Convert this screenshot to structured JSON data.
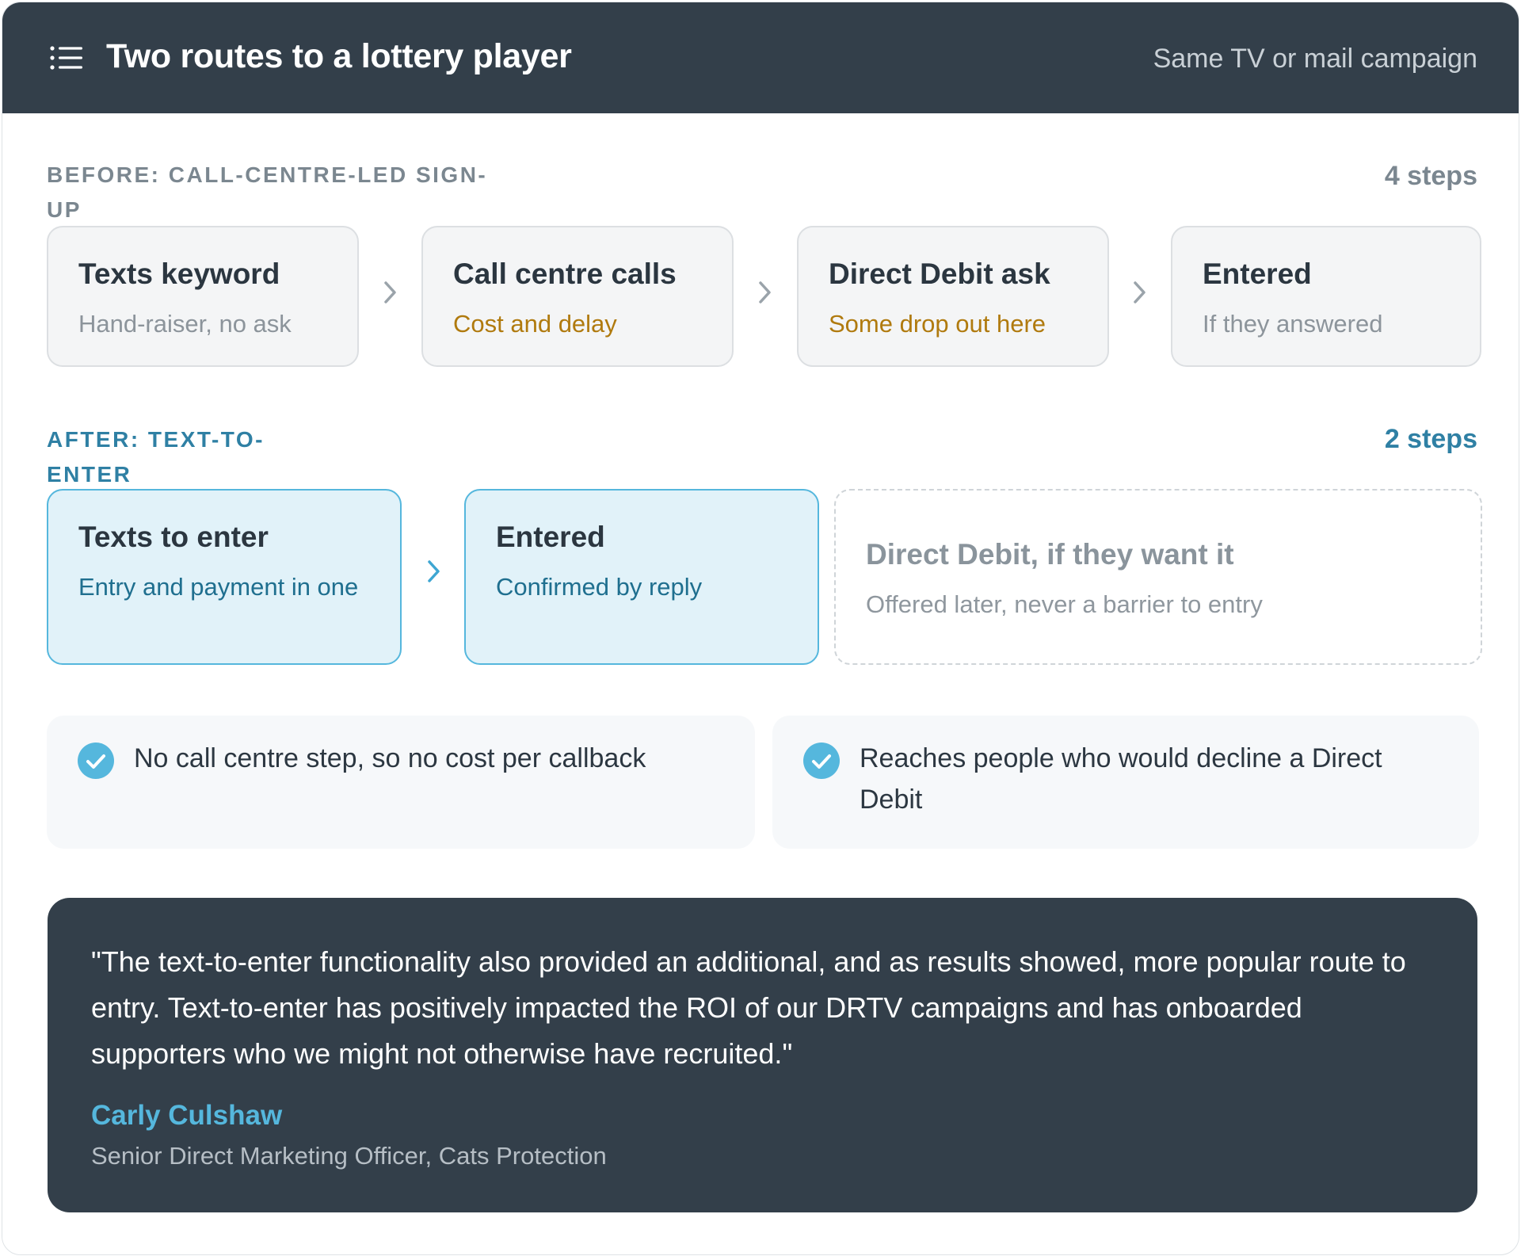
{
  "header": {
    "title": "Two routes to a lottery player",
    "subtitle": "Same TV or mail campaign",
    "icon": "list-icon"
  },
  "before": {
    "label": "BEFORE: CALL-CENTRE-LED SIGN-UP",
    "count": "4 steps",
    "steps": [
      {
        "title": "Texts keyword",
        "subtitle": "Hand-raiser, no ask",
        "tone": "grey"
      },
      {
        "title": "Call centre calls",
        "subtitle": "Cost and delay",
        "tone": "amber"
      },
      {
        "title": "Direct Debit ask",
        "subtitle": "Some drop out here",
        "tone": "amber"
      },
      {
        "title": "Entered",
        "subtitle": "If they answered",
        "tone": "grey"
      }
    ]
  },
  "after": {
    "label": "AFTER: TEXT-TO-ENTER",
    "count": "2 steps",
    "steps": [
      {
        "title": "Texts to enter",
        "subtitle": "Entry and payment in one"
      },
      {
        "title": "Entered",
        "subtitle": "Confirmed by reply"
      }
    ],
    "optional": {
      "title": "Direct Debit, if they want it",
      "subtitle": "Offered later, never a barrier to entry"
    }
  },
  "benefits": [
    {
      "text": "No call centre step, so no cost per callback",
      "icon": "check-circle-icon"
    },
    {
      "text": "Reaches people who would decline a Direct Debit",
      "icon": "check-circle-icon"
    }
  ],
  "quote": {
    "text": "\"The text-to-enter functionality also provided an additional, and as results showed, more popular route to entry. Text-to-enter has positively impacted the ROI of our DRTV campaigns and has onboarded supporters who we might not otherwise have recruited.\"",
    "name": "Carly Culshaw",
    "role": "Senior Direct Marketing Officer, Cats Protection"
  },
  "colors": {
    "header_bg": "#333f4a",
    "accent_blue": "#55b7dd",
    "label_blue": "#2f80a4",
    "amber": "#b07a0e",
    "muted": "#7b8790"
  }
}
